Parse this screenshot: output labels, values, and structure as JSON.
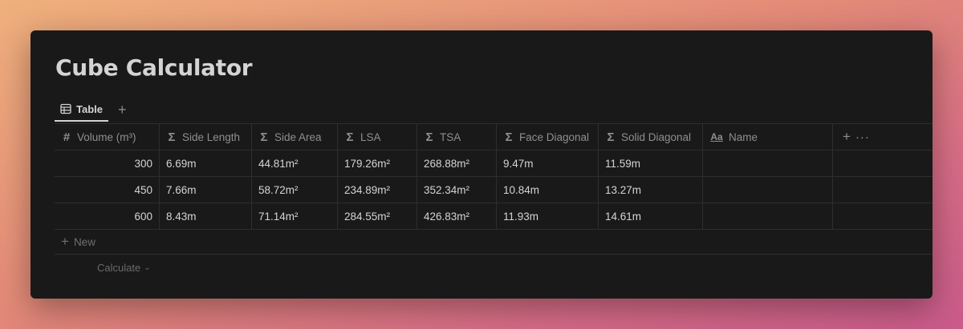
{
  "page": {
    "title": "Cube Calculator"
  },
  "views": {
    "active_tab": "Table",
    "tab_icon": "table-icon",
    "add_view_icon": "plus-icon"
  },
  "table": {
    "columns": [
      {
        "label": "Volume (m³)",
        "icon": "number-icon",
        "glyph": "#"
      },
      {
        "label": "Side Length",
        "icon": "formula-icon",
        "glyph": "Σ"
      },
      {
        "label": "Side Area",
        "icon": "formula-icon",
        "glyph": "Σ"
      },
      {
        "label": "LSA",
        "icon": "formula-icon",
        "glyph": "Σ"
      },
      {
        "label": "TSA",
        "icon": "formula-icon",
        "glyph": "Σ"
      },
      {
        "label": "Face Diagonal",
        "icon": "formula-icon",
        "glyph": "Σ"
      },
      {
        "label": "Solid Diagonal",
        "icon": "formula-icon",
        "glyph": "Σ"
      },
      {
        "label": "Name",
        "icon": "text-property-icon",
        "glyph": "Aa"
      }
    ],
    "rows": [
      {
        "volume": "300",
        "side_length": "6.69m",
        "side_area": "44.81m²",
        "lsa": "179.26m²",
        "tsa": "268.88m²",
        "face_diagonal": "9.47m",
        "solid_diagonal": "11.59m",
        "name": ""
      },
      {
        "volume": "450",
        "side_length": "7.66m",
        "side_area": "58.72m²",
        "lsa": "234.89m²",
        "tsa": "352.34m²",
        "face_diagonal": "10.84m",
        "solid_diagonal": "13.27m",
        "name": ""
      },
      {
        "volume": "600",
        "side_length": "8.43m",
        "side_area": "71.14m²",
        "lsa": "284.55m²",
        "tsa": "426.83m²",
        "face_diagonal": "11.93m",
        "solid_diagonal": "14.61m",
        "name": ""
      }
    ],
    "add_column_icon": "plus-icon",
    "more_icon": "more-horizontal-icon",
    "new_row_label": "New",
    "calculate_label": "Calculate"
  },
  "colors": {
    "background_gradient": [
      "#efb07c",
      "#e38a78",
      "#d66c86",
      "#c95a8a"
    ],
    "window_bg": "#191919",
    "text": "#d4d4d4",
    "muted": "#8f8f8f",
    "border": "#2e2e2e"
  }
}
